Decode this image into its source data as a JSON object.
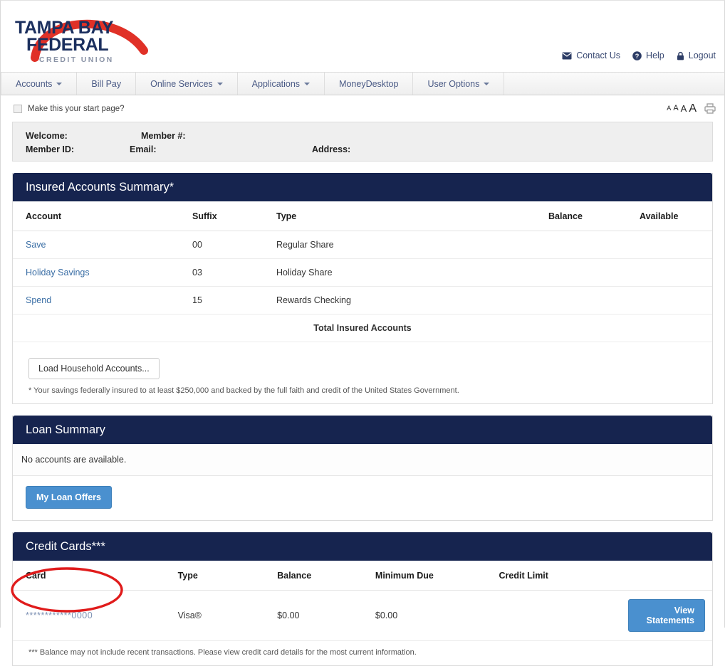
{
  "brand": {
    "name_line1": "TAMPA BAY",
    "name_line2": "FEDERAL",
    "tagline": "CREDIT UNION",
    "navy": "#1b2f5e",
    "red": "#e03127",
    "gray": "#8a93a6"
  },
  "util_nav": [
    {
      "label": "Contact Us",
      "icon": "envelope-icon"
    },
    {
      "label": "Help",
      "icon": "question-circle-icon"
    },
    {
      "label": "Logout",
      "icon": "lock-icon"
    }
  ],
  "main_nav": [
    {
      "label": "Accounts",
      "has_caret": true
    },
    {
      "label": "Bill Pay",
      "has_caret": false
    },
    {
      "label": "Online Services",
      "has_caret": true
    },
    {
      "label": "Applications",
      "has_caret": true
    },
    {
      "label": "MoneyDesktop",
      "has_caret": false
    },
    {
      "label": "User Options",
      "has_caret": true
    }
  ],
  "start_page": {
    "checkbox_label": "Make this your start page?",
    "checked": false
  },
  "text_size": {
    "sizes": [
      "A",
      "A",
      "A",
      "A"
    ],
    "print_icon": "printer-icon"
  },
  "welcome": {
    "welcome_label": "Welcome:",
    "welcome_value": "",
    "member_no_label": "Member #:",
    "member_no_value": "",
    "member_id_label": "Member ID:",
    "member_id_value": "",
    "email_label": "Email:",
    "email_value": "",
    "address_label": "Address:",
    "address_value": ""
  },
  "insured_accounts": {
    "title": "Insured Accounts Summary*",
    "columns": [
      "Account",
      "Suffix",
      "Type",
      "Balance",
      "Available"
    ],
    "rows": [
      {
        "account": "Save",
        "suffix": "00",
        "type": "Regular Share",
        "balance": "",
        "available": ""
      },
      {
        "account": "Holiday Savings",
        "suffix": "03",
        "type": "Holiday Share",
        "balance": "",
        "available": ""
      },
      {
        "account": "Spend",
        "suffix": "15",
        "type": "Rewards Checking",
        "balance": "",
        "available": ""
      }
    ],
    "total_label": "Total Insured Accounts",
    "load_button": "Load Household Accounts...",
    "footnote": "* Your savings federally insured to at least $250,000 and backed by the full faith and credit of the United States Government."
  },
  "loan_summary": {
    "title": "Loan Summary",
    "empty_message": "No accounts are available.",
    "offers_button": "My Loan Offers"
  },
  "credit_cards": {
    "title": "Credit Cards***",
    "columns": [
      "Card",
      "Type",
      "Balance",
      "Minimum Due",
      "Credit Limit"
    ],
    "rows": [
      {
        "card_mask": "************",
        "card_last4": "0000",
        "type": "Visa®",
        "balance": "$0.00",
        "minimum_due": "$0.00",
        "credit_limit": "",
        "action_label": "View Statements"
      }
    ],
    "footnote": "*** Balance may not include recent transactions. Please view credit card details for the most current information."
  },
  "annotation": {
    "shape": "ellipse",
    "color": "#e01b1b",
    "target": "credit-card-number"
  }
}
